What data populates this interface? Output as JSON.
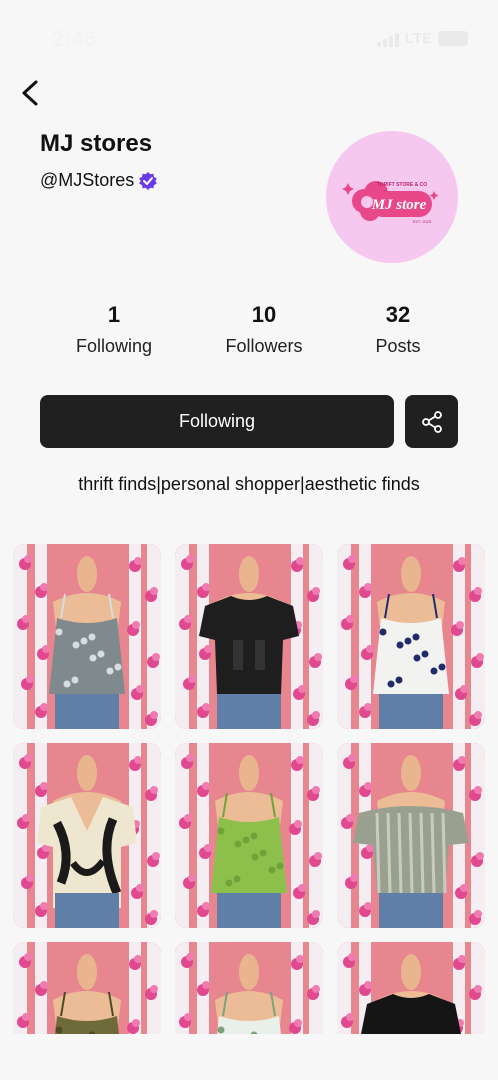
{
  "status_bar": {
    "time": "2:46",
    "network": "LTE"
  },
  "profile": {
    "name": "MJ stores",
    "handle": "@MJStores",
    "avatar": {
      "brand": "MJ store",
      "tagline": "THRIFT STORE & CO",
      "est": "EST. 2023"
    }
  },
  "stats": [
    {
      "count": "1",
      "label": "Following"
    },
    {
      "count": "10",
      "label": "Followers"
    },
    {
      "count": "32",
      "label": "Posts"
    }
  ],
  "actions": {
    "follow_label": "Following"
  },
  "bio": "thrift finds|personal shopper|aesthetic finds",
  "colors": {
    "button_bg": "#202020",
    "verified": "#6c3be8",
    "avatar_bg": "#f6c8f0",
    "logo_pink": "#e8488a"
  },
  "posts": [
    {
      "item": "gray patterned cami top",
      "top": "#7f8a8e",
      "accent": "#d8dde0",
      "style": "cami"
    },
    {
      "item": "black t-shirt",
      "top": "#1e1e1e",
      "accent": "#333333",
      "style": "tee"
    },
    {
      "item": "navy floral top",
      "top": "#f2f2f0",
      "accent": "#1f2c6b",
      "style": "cami"
    },
    {
      "item": "black and cream print shirt",
      "top": "#efe6cf",
      "accent": "#1a1a1a",
      "style": "shirt"
    },
    {
      "item": "green crop top",
      "top": "#8cc04a",
      "accent": "#6fa33a",
      "style": "cami"
    },
    {
      "item": "striped off-shoulder top",
      "top": "#9aa08f",
      "accent": "#c9cbbf",
      "style": "offshoulder"
    },
    {
      "item": "olive strap top",
      "top": "#6f6a3a",
      "accent": "#4d4a28",
      "style": "cami"
    },
    {
      "item": "floral bustier top",
      "top": "#e9efe9",
      "accent": "#7da07d",
      "style": "cami"
    },
    {
      "item": "black long sleeve top",
      "top": "#151515",
      "accent": "#2a2a2a",
      "style": "tee"
    }
  ]
}
